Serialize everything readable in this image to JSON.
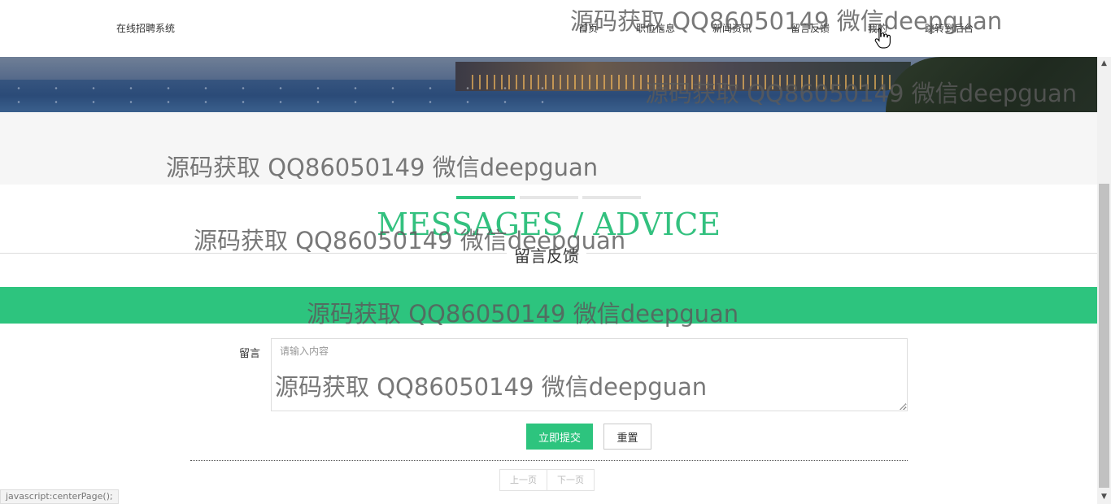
{
  "header": {
    "site_title": "在线招聘系统",
    "nav": [
      {
        "label": "首页",
        "key": "home"
      },
      {
        "label": "职位信息",
        "key": "jobs"
      },
      {
        "label": "新闻资讯",
        "key": "news"
      },
      {
        "label": "留言反馈",
        "key": "messages"
      },
      {
        "label": "我的",
        "key": "mine"
      },
      {
        "label": "跳转到后台",
        "key": "admin"
      }
    ]
  },
  "section": {
    "title_en": "MESSAGES / ADVICE",
    "title_cn": "留言反馈",
    "accent_color": "#2dc47e"
  },
  "form": {
    "label": "留言",
    "placeholder": "请输入内容",
    "submit_label": "立即提交",
    "reset_label": "重置"
  },
  "pager": {
    "prev_label": "上一页",
    "next_label": "下一页"
  },
  "status_bar": {
    "text": "javascript:centerPage();"
  },
  "watermark": {
    "text": "源码获取 QQ86050149 微信deepguan"
  },
  "icons": {
    "cursor": "hand-pointer-icon",
    "scroll_up": "scroll-up-arrow-icon",
    "scroll_down": "scroll-down-arrow-icon"
  }
}
